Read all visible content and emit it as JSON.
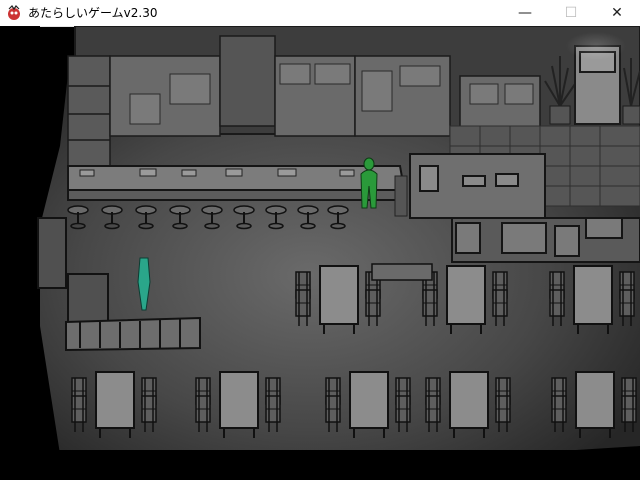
{
  "window": {
    "title": "あたらしいゲームv2.30",
    "controls": {
      "minimize": "—",
      "maximize": "☐",
      "close": "✕"
    }
  },
  "scene": {
    "setting": "cafeteria",
    "characters": [
      {
        "name": "green-figure",
        "color": "#2a9a3a"
      },
      {
        "name": "teal-figure",
        "color": "#2aa68a"
      }
    ]
  },
  "colors": {
    "floor": "#4a4a4a",
    "void": "#000000",
    "titlebar": "#ffffff"
  }
}
